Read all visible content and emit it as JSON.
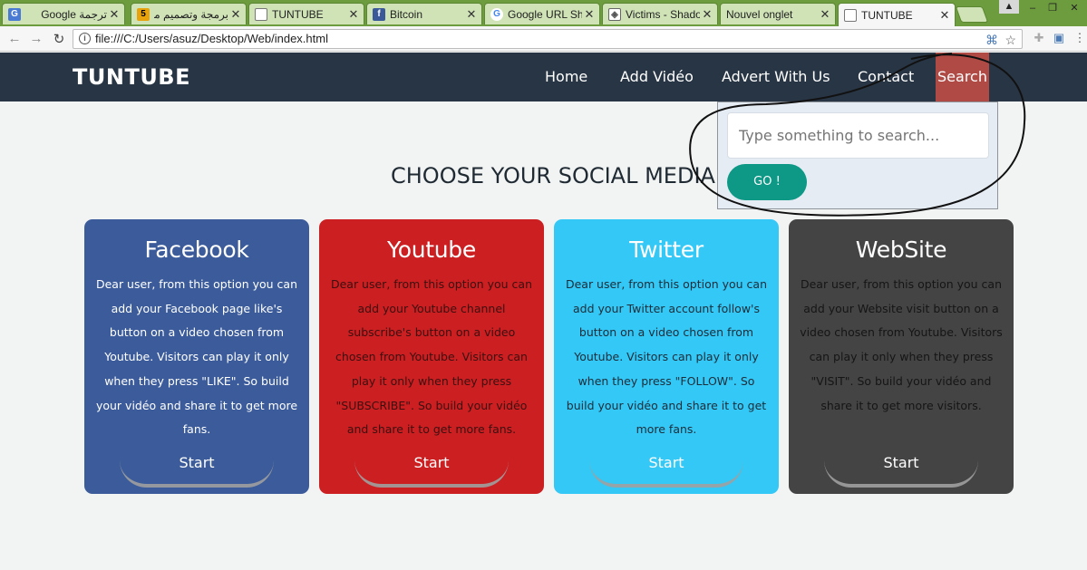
{
  "browser": {
    "tabs": [
      {
        "title": "ترجمة Google",
        "icon": "translate-icon",
        "color": "#4a7bd4"
      },
      {
        "title": "برمجة وتصميم مو",
        "icon": "numbered-5-icon",
        "color": "#e8a30c"
      },
      {
        "title": "TUNTUBE",
        "icon": "page-icon",
        "color": "#ffffff"
      },
      {
        "title": "Bitcoin",
        "icon": "facebook-icon",
        "color": "#3b5998"
      },
      {
        "title": "Google URL Sho",
        "icon": "google-icon",
        "color": "#ffffff"
      },
      {
        "title": "Victims - Shado",
        "icon": "shield-icon",
        "color": "#ffffff"
      },
      {
        "title": "Nouvel onglet",
        "icon": "blank-icon",
        "color": "#ffffff"
      },
      {
        "title": "TUNTUBE",
        "icon": "page-icon",
        "color": "#ffffff",
        "active": true
      }
    ],
    "url": "file:///C:/Users/asuz/Desktop/Web/index.html"
  },
  "site": {
    "logo": "TUNTUBE",
    "nav": {
      "home": "Home",
      "add_video": "Add Vidéo",
      "advert": "Advert With Us",
      "contact": "Contact",
      "search": "Search"
    },
    "search": {
      "placeholder": "Type something to search...",
      "go": "GO !"
    },
    "heading": "CHOOSE YOUR SOCIAL MEDIA",
    "cards": [
      {
        "title": "Facebook",
        "text": "Dear user, from this option you can add your Facebook page like's button on a video chosen from Youtube. Visitors can play it only when they press \"LIKE\". So build your vidéo and share it to get more fans.",
        "button": "Start",
        "color": "#3b5b9a"
      },
      {
        "title": "Youtube",
        "text": "Dear user, from this option you can add your Youtube channel subscribe's button on a video chosen from Youtube. Visitors can play it only when they press \"SUBSCRIBE\". So build your vidéo and share it to get more fans.",
        "button": "Start",
        "color": "#cc1f22"
      },
      {
        "title": "Twitter",
        "text": "Dear user, from this option you can add your Twitter account follow's button on a video chosen from Youtube. Visitors can play it only when they press \"FOLLOW\". So build your vidéo and share it to get more fans.",
        "button": "Start",
        "color": "#33c8f6"
      },
      {
        "title": "WebSite",
        "text": "Dear user, from this option you can add your Website visit button on a video chosen from Youtube. Visitors can play it only when they press \"VISIT\". So build your vidéo and share it to get more visitors.",
        "button": "Start",
        "color": "#454444"
      }
    ]
  }
}
